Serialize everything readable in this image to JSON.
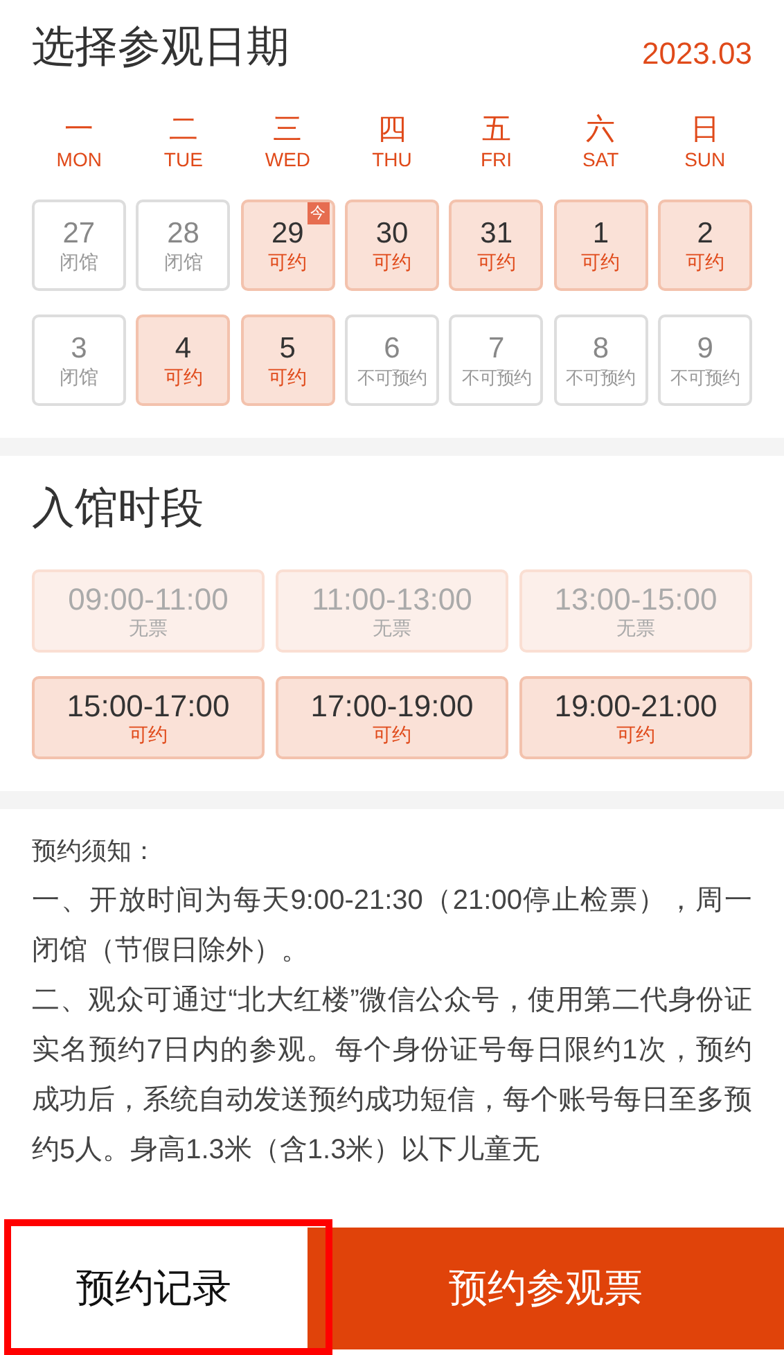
{
  "date_section": {
    "title": "选择参观日期",
    "month": "2023.03",
    "weekdays": [
      {
        "cn": "一",
        "en": "MON"
      },
      {
        "cn": "二",
        "en": "TUE"
      },
      {
        "cn": "三",
        "en": "WED"
      },
      {
        "cn": "四",
        "en": "THU"
      },
      {
        "cn": "五",
        "en": "FRI"
      },
      {
        "cn": "六",
        "en": "SAT"
      },
      {
        "cn": "日",
        "en": "SUN"
      }
    ],
    "days": [
      {
        "day": "27",
        "status": "闭馆",
        "kind": "closed"
      },
      {
        "day": "28",
        "status": "闭馆",
        "kind": "closed"
      },
      {
        "day": "29",
        "status": "可约",
        "kind": "available",
        "today_badge": "今"
      },
      {
        "day": "30",
        "status": "可约",
        "kind": "available"
      },
      {
        "day": "31",
        "status": "可约",
        "kind": "available"
      },
      {
        "day": "1",
        "status": "可约",
        "kind": "available"
      },
      {
        "day": "2",
        "status": "可约",
        "kind": "available"
      },
      {
        "day": "3",
        "status": "闭馆",
        "kind": "closed"
      },
      {
        "day": "4",
        "status": "可约",
        "kind": "available"
      },
      {
        "day": "5",
        "status": "可约",
        "kind": "available"
      },
      {
        "day": "6",
        "status": "不可预约",
        "kind": "unavailable"
      },
      {
        "day": "7",
        "status": "不可预约",
        "kind": "unavailable"
      },
      {
        "day": "8",
        "status": "不可预约",
        "kind": "unavailable"
      },
      {
        "day": "9",
        "status": "不可预约",
        "kind": "unavailable"
      }
    ]
  },
  "slot_section": {
    "title": "入馆时段",
    "slots": [
      {
        "time": "09:00-11:00",
        "status": "无票",
        "disabled": true
      },
      {
        "time": "11:00-13:00",
        "status": "无票",
        "disabled": true
      },
      {
        "time": "13:00-15:00",
        "status": "无票",
        "disabled": true
      },
      {
        "time": "15:00-17:00",
        "status": "可约",
        "disabled": false
      },
      {
        "time": "17:00-19:00",
        "status": "可约",
        "disabled": false
      },
      {
        "time": "19:00-21:00",
        "status": "可约",
        "disabled": false
      }
    ]
  },
  "notice": {
    "title": "预约须知：",
    "paragraphs": [
      "一、开放时间为每天9:00-21:30（21:00停止检票），周一闭馆（节假日除外）。",
      "二、观众可通过“北大红楼”微信公众号，使用第二代身份证实名预约7日内的参观。每个身份证号每日限约1次，预约成功后，系统自动发送预约成功短信，每个账号每日至多预约5人。身高1.3米（含1.3米）以下儿童无"
    ]
  },
  "bottom_bar": {
    "buttons": [
      {
        "label": "预约记录",
        "kind": "secondary",
        "highlighted": true
      },
      {
        "label": "预约参观票",
        "kind": "primary",
        "highlighted": false
      }
    ]
  }
}
